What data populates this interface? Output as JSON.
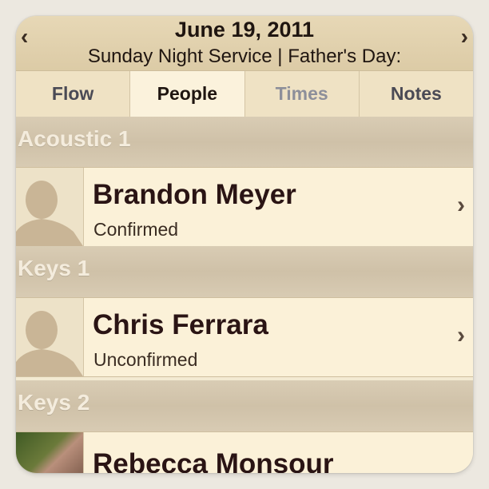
{
  "header": {
    "date": "June 19, 2011",
    "subtitle": "Sunday Night Service | Father's Day:",
    "prev_icon": "chevron-left-icon",
    "next_icon": "chevron-right-icon"
  },
  "tabs": [
    {
      "label": "Flow",
      "state": "normal"
    },
    {
      "label": "People",
      "state": "active"
    },
    {
      "label": "Times",
      "state": "dim"
    },
    {
      "label": "Notes",
      "state": "normal"
    }
  ],
  "sections": [
    {
      "title": "Acoustic 1",
      "person": {
        "name": "Brandon Meyer",
        "status": "Confirmed",
        "avatar": "person-silhouette-icon"
      }
    },
    {
      "title": "Keys 1",
      "person": {
        "name": "Chris Ferrara",
        "status": "Unconfirmed",
        "avatar": "person-silhouette-icon"
      }
    },
    {
      "title": "Keys 2",
      "person": {
        "name": "Rebecca Monsour",
        "status": "",
        "avatar": "photo"
      }
    }
  ],
  "colors": {
    "header_bg": "#e2d2ae",
    "row_bg": "#fbf1d8",
    "section_bg": "#d2c5ad",
    "text_dark": "#2a1414"
  }
}
